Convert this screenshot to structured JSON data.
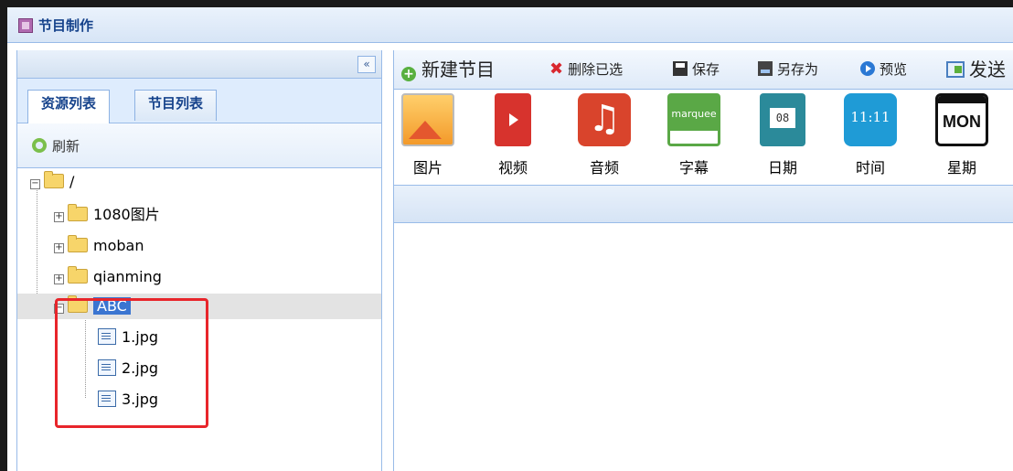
{
  "window": {
    "title": "节目制作"
  },
  "left_panel": {
    "collapse_label": "«",
    "tabs": [
      {
        "label": "资源列表",
        "active": true
      },
      {
        "label": "节目列表",
        "active": false
      }
    ],
    "refresh_label": "刷新",
    "tree": {
      "root": {
        "label": "/",
        "expanded": true
      },
      "folders": [
        {
          "label": "1080图片",
          "expanded": false
        },
        {
          "label": "moban",
          "expanded": false
        },
        {
          "label": "qianming",
          "expanded": false
        },
        {
          "label": "ABC",
          "expanded": true,
          "selected": true
        }
      ],
      "files": [
        {
          "label": "1.jpg"
        },
        {
          "label": "2.jpg"
        },
        {
          "label": "3.jpg"
        }
      ]
    },
    "expander_plus": "+",
    "expander_minus": "−"
  },
  "right_panel": {
    "toolbar": {
      "new_program": "新建节目",
      "delete_selected": "删除已选",
      "save": "保存",
      "save_as": "另存为",
      "preview": "预览",
      "send": "发送"
    },
    "palette": [
      {
        "label": "图片",
        "icon": "picture-icon"
      },
      {
        "label": "视频",
        "icon": "video-icon"
      },
      {
        "label": "音频",
        "icon": "audio-icon"
      },
      {
        "label": "字幕",
        "icon": "marquee-icon",
        "icon_text": "marquee"
      },
      {
        "label": "日期",
        "icon": "date-icon",
        "icon_text": "08"
      },
      {
        "label": "时间",
        "icon": "time-icon",
        "icon_text": "11:11"
      },
      {
        "label": "星期",
        "icon": "weekday-icon",
        "icon_text": "MON"
      }
    ]
  },
  "colors": {
    "accent": "#3b75d1",
    "highlight": "#e8252b",
    "panel_border": "#99bbe8"
  }
}
